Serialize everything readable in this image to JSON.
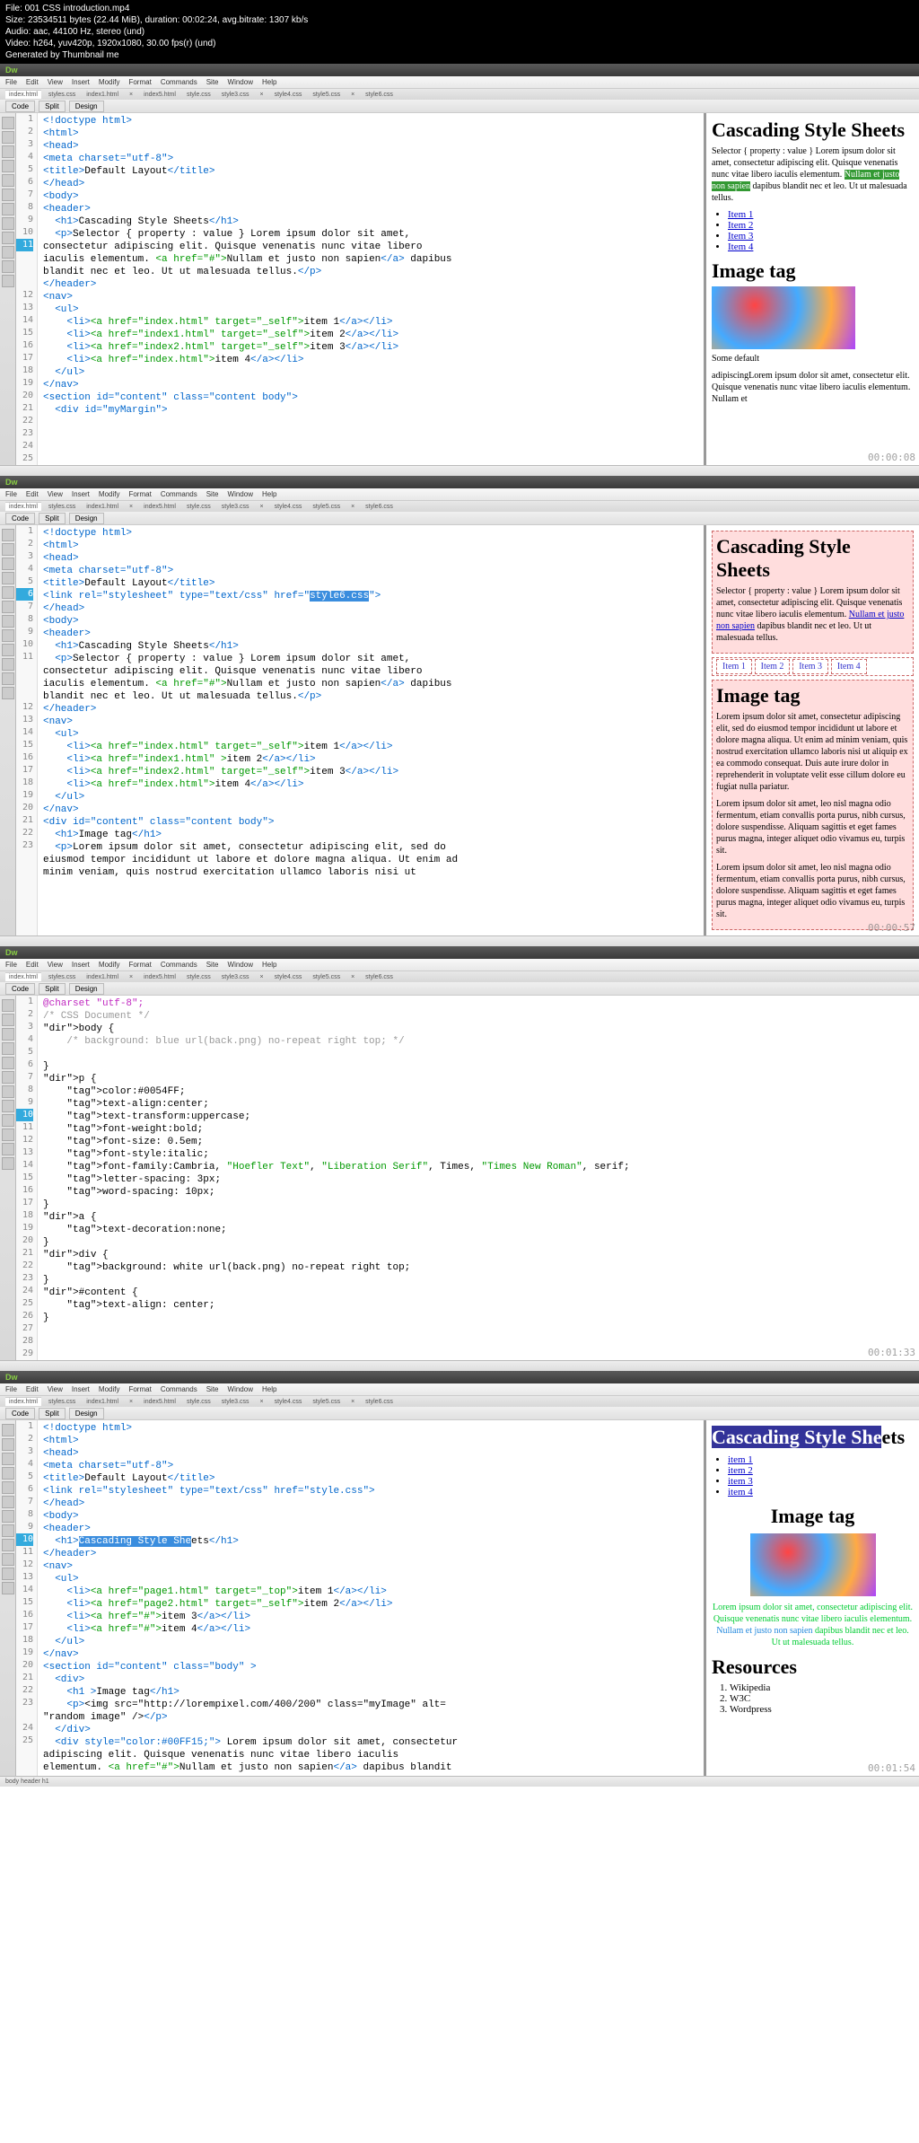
{
  "header": {
    "file": "File: 001 CSS introduction.mp4",
    "size": "Size: 23534511 bytes (22.44 MiB), duration: 00:02:24, avg.bitrate: 1307 kb/s",
    "audio": "Audio: aac, 44100 Hz, stereo (und)",
    "video": "Video: h264, yuv420p, 1920x1080, 30.00 fps(r) (und)",
    "gen": "Generated by Thumbnail me"
  },
  "menu": [
    "File",
    "Edit",
    "View",
    "Insert",
    "Modify",
    "Format",
    "Commands",
    "Site",
    "Window",
    "Help"
  ],
  "tabs": [
    "index.html",
    "styles.css",
    "index1.html",
    "×",
    "index5.html",
    "style.css",
    "style3.css",
    "×",
    "style4.css",
    "style5.css",
    "×",
    "style6.css"
  ],
  "views": [
    "Code",
    "Split",
    "Design"
  ],
  "pane1": {
    "hl_line": 11,
    "code_lines": [
      "<!doctype html>",
      "<html>",
      "<head>",
      "<meta charset=\"utf-8\">",
      "<title>Default Layout</title>",
      "",
      "</head>",
      "<body>",
      "<header>",
      "  <h1>Cascading Style Sheets</h1>",
      "  <p>Selector { property : value } Lorem ipsum dolor sit amet,",
      "consectetur adipiscing elit. Quisque venenatis nunc vitae libero",
      "iaculis elementum. <a href=\"#\">Nullam et justo non sapien</a> dapibus",
      "blandit nec et leo. Ut ut malesuada tellus.</p>",
      "</header>",
      "<nav>",
      "  <ul>",
      "    <li><a href=\"index.html\" target=\"_self\">item 1</a></li>",
      "    <li><a href=\"index1.html\" target=\"_self\">item 2</a></li>",
      "    <li><a href=\"index2.html\" target=\"_self\">item 3</a></li>",
      "    <li><a href=\"index.html\">item 4</a></li>",
      "  </ul>",
      "</nav>",
      "",
      "",
      "",
      "<section id=\"content\" class=\"content body\">",
      "  <div id=\"myMargin\">"
    ],
    "preview": {
      "h1": "Cascading Style Sheets",
      "p1_before": "Selector { property : value } Lorem ipsum dolor sit amet, consectetur adipiscing elit. Quisque venenatis nunc vitae libero iaculis elementum. ",
      "p1_hl": "Nullam et justo non sapien",
      "p1_after": " dapibus blandit nec et leo. Ut ut malesuada tellus.",
      "items": [
        "Item 1",
        "Item 2",
        "Item 3",
        "Item 4"
      ],
      "h2": "Image tag",
      "caption": "Some default",
      "p2": "adipiscingLorem ipsum dolor sit amet, consectetur elit. Quisque venenatis nunc vitae libero iaculis elementum. Nullam et"
    },
    "timecode": "00:00:08"
  },
  "pane2": {
    "hl_line": 6,
    "sel_text": "style6.css",
    "code_lines": [
      "<!doctype html>",
      "<html>",
      "<head>",
      "<meta charset=\"utf-8\">",
      "<title>Default Layout</title>",
      "<link rel=\"stylesheet\" type=\"text/css\" href=\"style6.css\">",
      "</head>",
      "<body>",
      "<header>",
      "  <h1>Cascading Style Sheets</h1>",
      "  <p>Selector { property : value } Lorem ipsum dolor sit amet,",
      "consectetur adipiscing elit. Quisque venenatis nunc vitae libero",
      "iaculis elementum. <a href=\"#\">Nullam et justo non sapien</a> dapibus",
      "blandit nec et leo. Ut ut malesuada tellus.</p>",
      "</header>",
      "<nav>",
      "  <ul>",
      "    <li><a href=\"index.html\" target=\"_self\">item 1</a></li>",
      "    <li><a href=\"index1.html\" >item 2</a></li>",
      "    <li><a href=\"index2.html\" target=\"_self\">item 3</a></li>",
      "    <li><a href=\"index.html\">item 4</a></li>",
      "  </ul>",
      "</nav>",
      "<div id=\"content\" class=\"content body\">",
      "  <h1>Image tag</h1>",
      "  <p>Lorem ipsum dolor sit amet, consectetur adipiscing elit, sed do",
      "eiusmod tempor incididunt ut labore et dolore magna aliqua. Ut enim ad",
      "minim veniam, quis nostrud exercitation ullamco laboris nisi ut"
    ],
    "preview": {
      "h1": "Cascading Style Sheets",
      "p1_before": "Selector { property : value } Lorem ipsum dolor sit amet, consectetur adipiscing elit. Quisque venenatis nunc vitae libero iaculis elementum. ",
      "p1_link": "Nullam et justo non sapien",
      "p1_after": " dapibus blandit nec et leo. Ut ut malesuada tellus.",
      "items": [
        "Item 1",
        "Item 2",
        "Item 3",
        "Item 4"
      ],
      "h2": "Image tag",
      "p2": "Lorem ipsum dolor sit amet, consectetur adipiscing elit, sed do eiusmod tempor incididunt ut labore et dolore magna aliqua. Ut enim ad minim veniam, quis nostrud exercitation ullamco laboris nisi ut aliquip ex ea commodo consequat. Duis aute irure dolor in reprehenderit in voluptate velit esse cillum dolore eu fugiat nulla pariatur.",
      "p3": "Lorem ipsum dolor sit amet, leo nisl magna odio fermentum, etiam convallis porta purus, nibh cursus, dolore suspendisse. Aliquam sagittis et eget fames purus magna, integer aliquet odio vivamus eu, turpis sit.",
      "p4": "Lorem ipsum dolor sit amet, leo nisl magna odio fermentum, etiam convallis porta purus, nibh cursus, dolore suspendisse. Aliquam sagittis et eget fames purus magna, integer aliquet odio vivamus eu, turpis sit."
    },
    "timecode": "00:00:57"
  },
  "pane3": {
    "hl_line": 10,
    "code_lines": [
      "@charset \"utf-8\";",
      "/* CSS Document */",
      "body {",
      "    /* background: blue url(back.png) no-repeat right top; */",
      "    ",
      "}",
      "p {",
      "    color:#0054FF;",
      "    text-align:center;",
      "    text-transform:uppercase;",
      "    font-weight:bold;",
      "    font-size: 0.5em;",
      "    font-style:italic;",
      "    font-family:Cambria, \"Hoefler Text\", \"Liberation Serif\", Times, \"Times New Roman\", serif;",
      "    letter-spacing: 3px;",
      "    word-spacing: 10px;",
      "}",
      "",
      "a {",
      "    text-decoration:none;",
      "}",
      "",
      "div {",
      "    background: white url(back.png) no-repeat right top;",
      "}",
      "#content {",
      "    text-align: center;",
      "}",
      ""
    ],
    "timecode": "00:01:33"
  },
  "pane4": {
    "hl_line": 10,
    "sel_text": "Cascading Style She",
    "code_lines": [
      "<!doctype html>",
      "<html>",
      "<head>",
      "<meta charset=\"utf-8\">",
      "<title>Default Layout</title>",
      "<link rel=\"stylesheet\" type=\"text/css\" href=\"style.css\">",
      "</head>",
      "<body>",
      "<header>",
      "  <h1>Cascading Style Sheets</h1>",
      "</header>",
      "<nav>",
      "  <ul>",
      "    <li><a href=\"page1.html\" target=\"_top\">item 1</a></li>",
      "    <li><a href=\"page2.html\" target=\"_self\">item 2</a></li>",
      "    <li><a href=\"#\">item 3</a></li>",
      "    <li><a href=\"#\">item 4</a></li>",
      "  </ul>",
      "</nav>",
      "<section id=\"content\" class=\"body\" >",
      "  <div>",
      "    <h1 >Image tag</h1>",
      "    <p><img src=\"http://lorempixel.com/400/200\" class=\"myImage\" alt=",
      "\"random image\" /></p>",
      "  </div>",
      "  <div style=\"color:#00FF15;\"> Lorem ipsum dolor sit amet, consectetur",
      "adipiscing elit. Quisque venenatis nunc vitae libero iaculis",
      "elementum. <a href=\"#\">Nullam et justo non sapien</a> dapibus blandit"
    ],
    "preview": {
      "h1_sel": "Cascading Style She",
      "h1_rest": "ets",
      "items": [
        "item 1",
        "item 2",
        "item 3",
        "item 4"
      ],
      "h2": "Image tag",
      "green_p": "Lorem ipsum dolor sit amet, consectetur adipiscing elit. Quisque venenatis nunc vitae libero iaculis elementum. ",
      "green_link": "Nullam et justo non sapien",
      "green_p2": " dapibus blandit nec et leo. Ut ut malesuada tellus.",
      "res_h": "Resources",
      "res": [
        "Wikipedia",
        "W3C",
        "Wordpress"
      ]
    },
    "timecode": "00:01:54"
  },
  "status": "body   header   h1"
}
